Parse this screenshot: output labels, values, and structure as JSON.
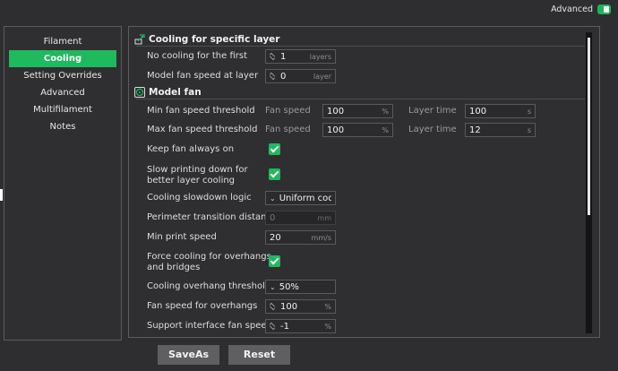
{
  "advanced": {
    "label": "Advanced",
    "enabled": true
  },
  "sidebar": {
    "items": [
      {
        "label": "Filament",
        "active": false
      },
      {
        "label": "Cooling",
        "active": true
      },
      {
        "label": "Setting Overrides",
        "active": false
      },
      {
        "label": "Advanced",
        "active": false
      },
      {
        "label": "Multifilament",
        "active": false
      },
      {
        "label": "Notes",
        "active": false
      }
    ]
  },
  "cooling_specific": {
    "title": "Cooling for specific layer",
    "no_cooling_first": {
      "label": "No cooling for the first",
      "value": "1",
      "unit": "layers"
    },
    "model_fan_at_layer": {
      "label": "Model fan speed at layer",
      "value": "0",
      "unit": "layer"
    }
  },
  "model_fan": {
    "title": "Model fan",
    "min_fan": {
      "label": "Min fan speed threshold",
      "fan_label": "Fan speed",
      "fan_value": "100",
      "fan_unit": "%",
      "layer_label": "Layer time",
      "layer_value": "100",
      "layer_unit": "s"
    },
    "max_fan": {
      "label": "Max fan speed threshold",
      "fan_label": "Fan speed",
      "fan_value": "100",
      "fan_unit": "%",
      "layer_label": "Layer time",
      "layer_value": "12",
      "layer_unit": "s"
    },
    "keep_fan_on": {
      "label": "Keep fan always on",
      "checked": true
    },
    "slow_printing": {
      "label_line1": "Slow printing down for",
      "label_line2": "better layer cooling",
      "checked": true
    },
    "slowdown_logic": {
      "label": "Cooling slowdown logic",
      "value": "Uniform cool..."
    },
    "perimeter_transition": {
      "label": "Perimeter transition distance",
      "value": "0",
      "unit": "mm"
    },
    "min_print_speed": {
      "label": "Min print speed",
      "value": "20",
      "unit": "mm/s"
    },
    "force_cooling": {
      "label_line1": "Force cooling for overhangs",
      "label_line2": "and bridges",
      "checked": true
    },
    "overhang_threshold": {
      "label": "Cooling overhang threshold",
      "value": "50%"
    },
    "fan_overhangs": {
      "label": "Fan speed for overhangs",
      "value": "100",
      "unit": "%"
    },
    "support_interface_fan": {
      "label": "Support interface fan speed",
      "value": "-1",
      "unit": "%"
    }
  },
  "buttons": {
    "save_as": "SaveAs",
    "reset": "Reset"
  },
  "colors": {
    "accent": "#1fb95e",
    "background": "#2e2e30"
  }
}
